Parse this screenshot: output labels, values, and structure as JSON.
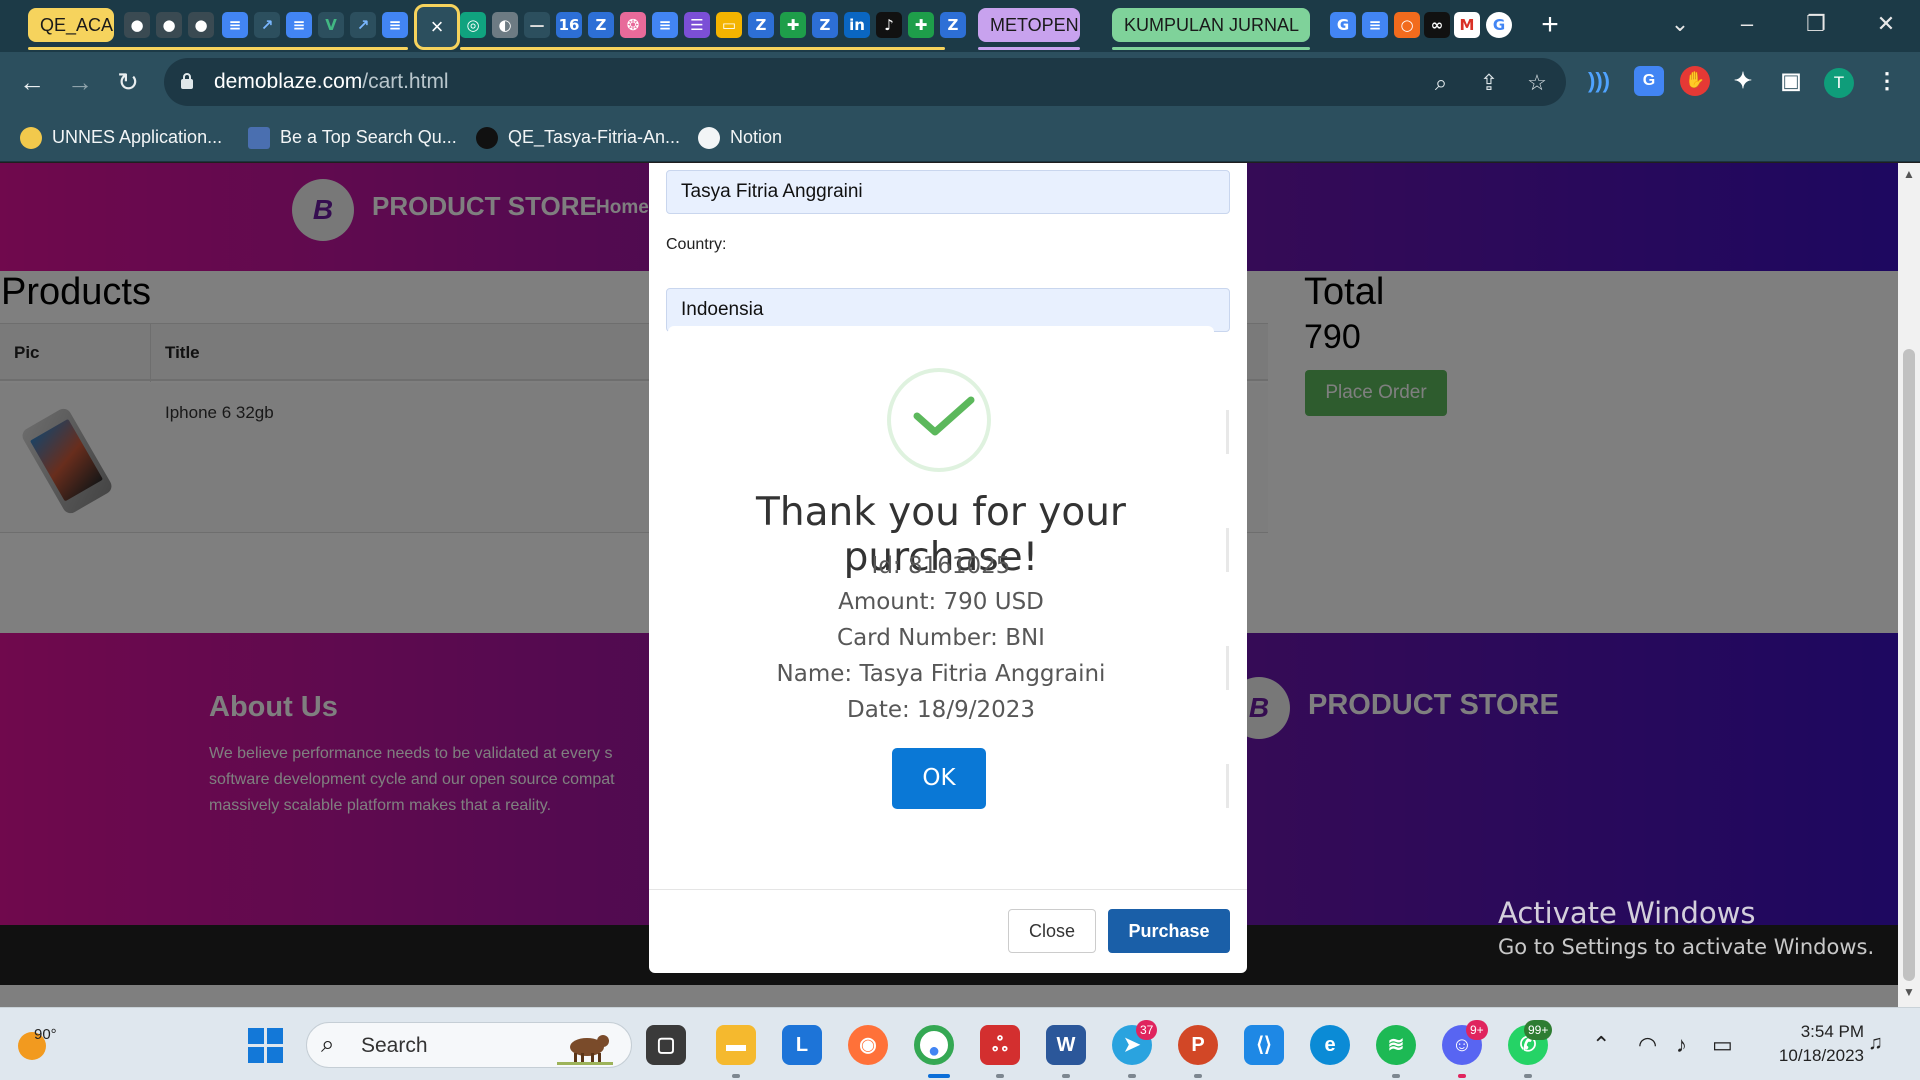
{
  "browser": {
    "tab_groups": [
      {
        "label": "QE_ACA",
        "color": "#f6d35d"
      },
      {
        "label": "METOPEN",
        "color": "#c8a2ee"
      },
      {
        "label": "KUMPULAN JURNAL",
        "color": "#7fd29a"
      }
    ],
    "active_tab_close": "×",
    "url_host": "demoblaze.com",
    "url_path": "/cart.html",
    "profile_initial": "T",
    "bookmarks": [
      {
        "label": "UNNES Application...",
        "icon": "unnes-icon"
      },
      {
        "label": "Be a Top Search Qu...",
        "icon": "bookmark-icon"
      },
      {
        "label": "QE_Tasya-Fitria-An...",
        "icon": "github-icon"
      },
      {
        "label": "Notion",
        "icon": "globe-icon"
      }
    ]
  },
  "page": {
    "brand": "PRODUCT STORE",
    "logo_letter": "B",
    "nav_home": "Home",
    "products_heading": "Products",
    "table_headers": [
      "Pic",
      "Title"
    ],
    "rows": [
      {
        "title": "Iphone 6 32gb"
      }
    ],
    "total_heading": "Total",
    "total_value": "790",
    "place_order": "Place Order",
    "about_title": "About Us",
    "about_text": "We believe performance needs to be validated at every s software development cycle and our open source compat massively scalable platform makes that a reality.",
    "footer_brand": "PRODUCT STORE"
  },
  "order_modal": {
    "name_value": "Tasya Fitria Anggraini",
    "country_label": "Country:",
    "country_value": "Indoensia",
    "close_label": "Close",
    "purchase_label": "Purchase"
  },
  "alert": {
    "title": "Thank you for your purchase!",
    "lines": [
      "Id: 8161025",
      "Amount: 790 USD",
      "Card Number: BNI",
      "Name: Tasya Fitria Anggraini",
      "Date: 18/9/2023"
    ],
    "ok_label": "OK",
    "success_color": "#5cb85c",
    "ok_color": "#0a78d6"
  },
  "watermark": {
    "title": "Activate Windows",
    "subtitle": "Go to Settings to activate Windows."
  },
  "taskbar": {
    "weather_temp": "90°",
    "search_placeholder": "Search",
    "telegram_badge": "37",
    "discord_badge": "9+",
    "whatsapp_badge": "99+",
    "time": "3:54 PM",
    "date": "10/18/2023"
  }
}
